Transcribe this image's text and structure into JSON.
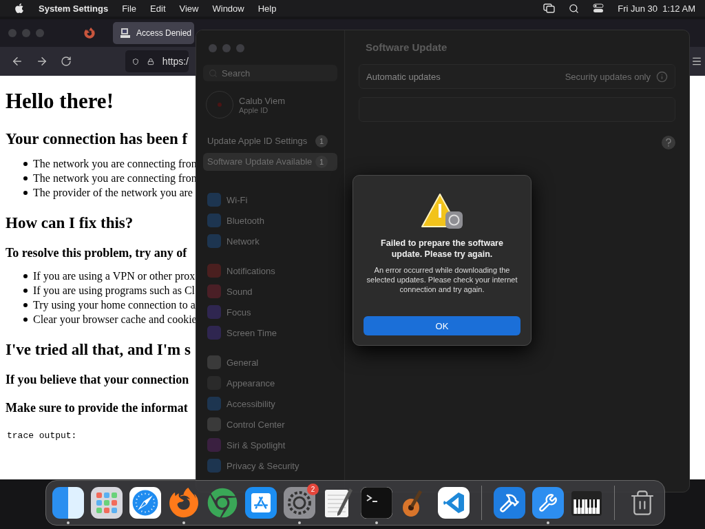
{
  "menubar": {
    "app": "System Settings",
    "menus": [
      "File",
      "Edit",
      "View",
      "Window",
      "Help"
    ],
    "clock": "Fri Jun 30  1:12 AM"
  },
  "browser": {
    "tab": {
      "title": "Access Denied",
      "selected": true
    },
    "url": "https:/",
    "content": [
      {
        "kind": "h1",
        "text": "Hello there!"
      },
      {
        "kind": "h2",
        "text": "Your connection has been f"
      },
      {
        "kind": "list",
        "items": [
          "The network you are connecting fron",
          "The network you are connecting fron",
          "The provider of the network you are"
        ]
      },
      {
        "kind": "h2",
        "text": "How can I fix this?"
      },
      {
        "kind": "h3",
        "text": "To resolve this problem, try any of"
      },
      {
        "kind": "list",
        "items": [
          "If you are using a VPN or other prox",
          "If you are using programs such as Cl",
          "Try using your home connection to a",
          "Clear your browser cache and cookie"
        ]
      },
      {
        "kind": "h2",
        "text": "I've tried all that, and I'm s"
      },
      {
        "kind": "h3",
        "text": "If you believe that your connection"
      },
      {
        "kind": "h3",
        "text": "Make sure to provide the informat"
      },
      {
        "kind": "pre",
        "text": "trace output:"
      }
    ]
  },
  "settings": {
    "sidebar": {
      "search": {
        "placeholder": "Search"
      },
      "account": {
        "name": "Calub Viem",
        "subtitle": "Apple ID"
      },
      "alerts": [
        {
          "label": "Update Apple ID Settings",
          "badge": "1",
          "selected": false
        },
        {
          "label": "Software Update Available",
          "badge": "1",
          "selected": true
        }
      ],
      "groups": [
        {
          "items": [
            {
              "label": "Wi-Fi",
              "color": "#1d3550"
            },
            {
              "label": "Bluetooth",
              "color": "#1d3550"
            },
            {
              "label": "Network",
              "color": "#1d3550"
            }
          ]
        },
        {
          "items": [
            {
              "label": "Notifications",
              "color": "#4a1f1f"
            },
            {
              "label": "Sound",
              "color": "#4a1f26"
            },
            {
              "label": "Focus",
              "color": "#2f2650"
            },
            {
              "label": "Screen Time",
              "color": "#2f2650"
            }
          ]
        },
        {
          "items": [
            {
              "label": "General",
              "color": "#3a3a3a"
            },
            {
              "label": "Appearance",
              "color": "#2a2a2a"
            },
            {
              "label": "Accessibility",
              "color": "#1d3550"
            },
            {
              "label": "Control Center",
              "color": "#3a3a3a"
            },
            {
              "label": "Siri & Spotlight",
              "color": "#3a2040"
            },
            {
              "label": "Privacy & Security",
              "color": "#1d3550"
            }
          ]
        }
      ]
    },
    "main": {
      "title": "Software Update",
      "rows": [
        {
          "label": "Automatic updates",
          "value": "Security updates only"
        }
      ]
    },
    "dialog": {
      "title": "Failed to prepare the software update. Please try again.",
      "message": "An error occurred while downloading the selected updates. Please check your internet connection and try again.",
      "button": "OK"
    }
  },
  "dock": {
    "sections": [
      {
        "items": [
          {
            "kind": "finder",
            "running": true
          },
          {
            "kind": "launchpad",
            "running": false
          },
          {
            "kind": "safari",
            "running": false
          },
          {
            "kind": "firefox",
            "running": true
          },
          {
            "kind": "chrome",
            "running": false
          },
          {
            "kind": "appstore",
            "running": false
          },
          {
            "kind": "settings",
            "running": true,
            "badge": "2"
          },
          {
            "kind": "notes",
            "running": false
          },
          {
            "kind": "terminal",
            "running": true
          },
          {
            "kind": "guitar",
            "running": false
          },
          {
            "kind": "code",
            "running": false
          }
        ]
      },
      {
        "items": [
          {
            "kind": "hammer",
            "running": false
          },
          {
            "kind": "tools",
            "running": true
          },
          {
            "kind": "piano",
            "running": false
          }
        ]
      },
      {
        "items": [
          {
            "kind": "trash",
            "running": false
          }
        ]
      }
    ]
  }
}
